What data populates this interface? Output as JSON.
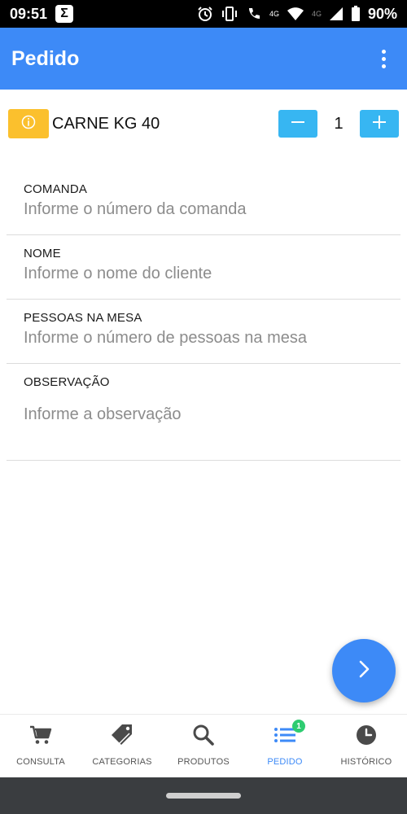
{
  "status": {
    "time": "09:51",
    "app_glyph": "Σ",
    "net_label_1": "4G",
    "net_label_2": "4G",
    "battery": "90%"
  },
  "app_bar": {
    "title": "Pedido",
    "menu_icon": "more-vert-icon"
  },
  "product": {
    "name": "CARNE KG 40",
    "quantity": "1",
    "info_icon": "info-icon",
    "minus_icon": "minus-icon",
    "plus_icon": "plus-icon"
  },
  "form": {
    "comanda": {
      "label": "COMANDA",
      "placeholder": "Informe o número da comanda",
      "value": ""
    },
    "nome": {
      "label": "NOME",
      "placeholder": "Informe o nome do cliente",
      "value": ""
    },
    "pessoas": {
      "label": "PESSOAS NA MESA",
      "placeholder": "Informe o número de pessoas na mesa",
      "value": ""
    },
    "observacao": {
      "label": "OBSERVAÇÃO",
      "placeholder": "Informe a observação",
      "value": ""
    }
  },
  "fab": {
    "icon": "chevron-right-icon"
  },
  "nav": {
    "items": [
      {
        "label": "CONSULTA",
        "icon": "cart-icon"
      },
      {
        "label": "CATEGORIAS",
        "icon": "tags-icon"
      },
      {
        "label": "PRODUTOS",
        "icon": "search-icon"
      },
      {
        "label": "PEDIDO",
        "icon": "list-icon",
        "badge": "1",
        "active": true
      },
      {
        "label": "HISTÓRICO",
        "icon": "clock-icon"
      }
    ]
  },
  "colors": {
    "primary": "#3d8af7",
    "info_button": "#fbc02d",
    "stepper_button": "#37b6f2",
    "badge": "#2ecc71",
    "nav_icon": "#4a4a4a"
  }
}
